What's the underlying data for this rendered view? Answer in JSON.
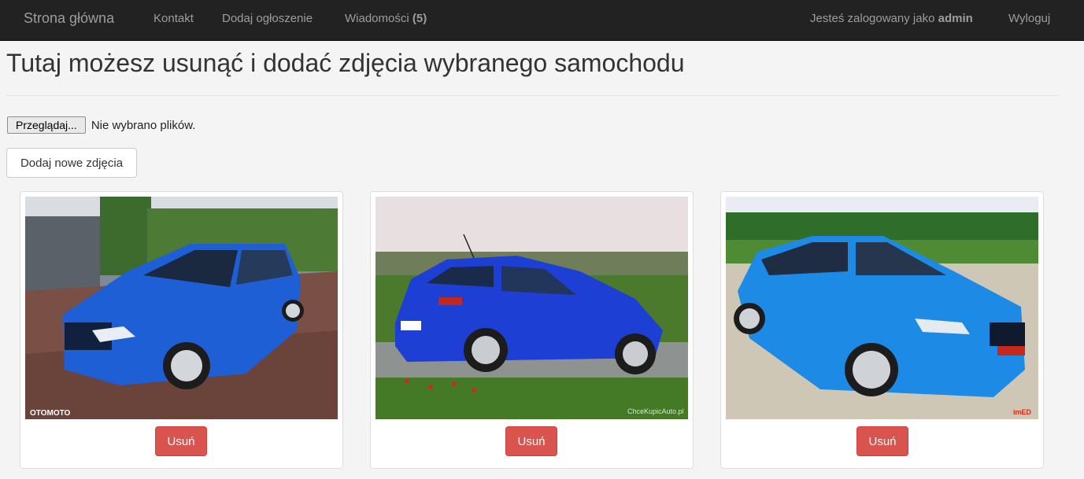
{
  "nav": {
    "brand": "Strona główna",
    "contact": "Kontakt",
    "add_listing": "Dodaj ogłoszenie",
    "messages_label": "Wiadomości",
    "messages_count": "(5)",
    "logged_prefix": "Jesteś zalogowany jako",
    "username": "admin",
    "logout": "Wyloguj"
  },
  "main": {
    "title": "Tutaj możesz usunąć i dodać zdjęcia wybranego samochodu",
    "file_button": "Przeglądaj...",
    "file_status": "Nie wybrano plików.",
    "add_photos_button": "Dodaj nowe zdjęcia"
  },
  "photos": [
    {
      "watermark": "OTOMOTO",
      "delete_label": "Usuń"
    },
    {
      "watermark": "ChceKupicAuto.pl",
      "delete_label": "Usuń"
    },
    {
      "watermark": "imED",
      "delete_label": "Usuń"
    }
  ],
  "colors": {
    "navbar": "#222222",
    "danger": "#d9534f",
    "car_blue": "#1f5fd6"
  }
}
